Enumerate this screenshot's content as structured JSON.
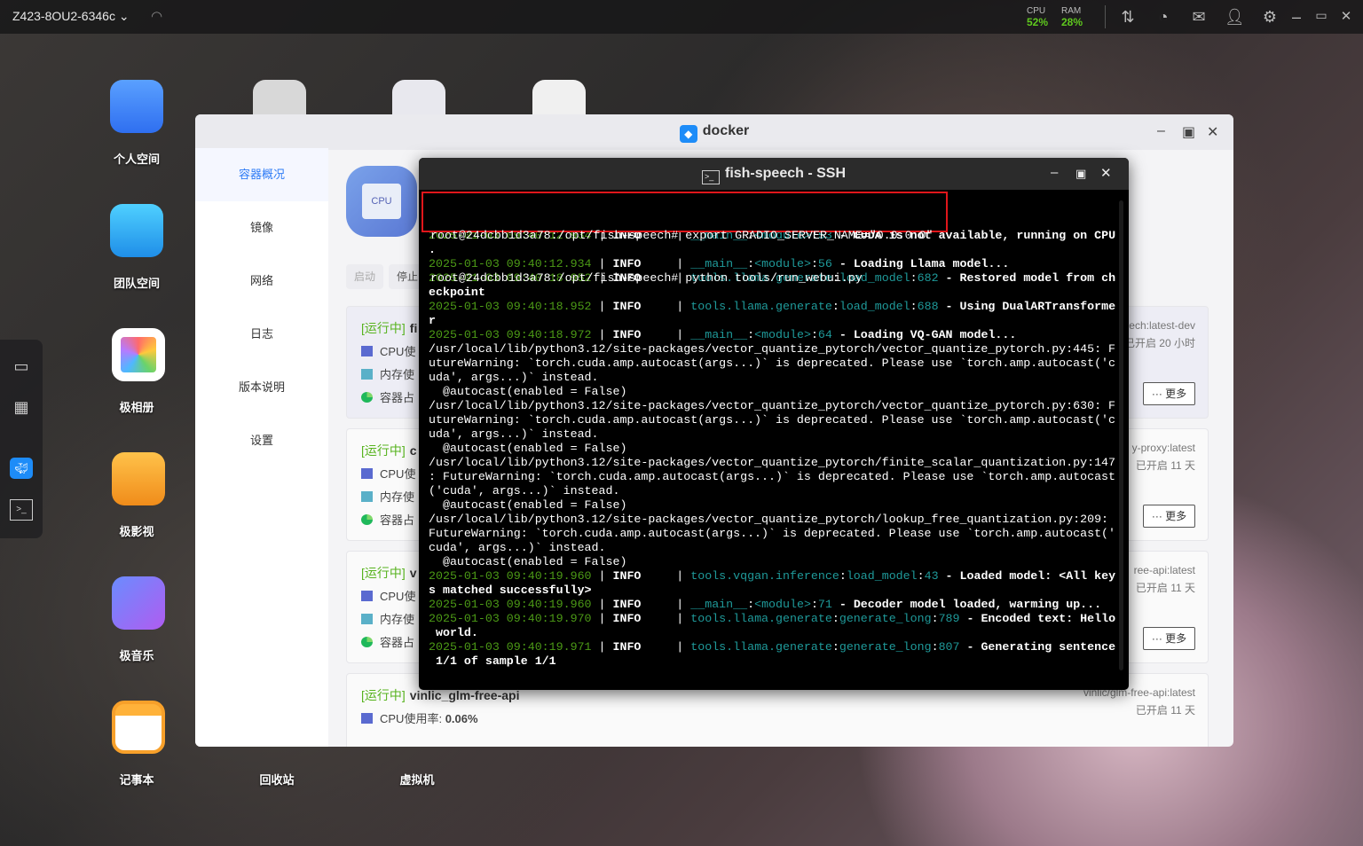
{
  "topbar": {
    "host": "Z423-8OU2-6346c",
    "cpu_label": "CPU",
    "cpu_value": "52%",
    "ram_label": "RAM",
    "ram_value": "28%",
    "accent": "#5fc81e"
  },
  "desktop": {
    "icons": [
      {
        "label": "个人空间",
        "icon": "folder-icon"
      },
      {
        "label": "团队空间",
        "icon": "team-folder-icon"
      },
      {
        "label": "极相册",
        "icon": "photos-icon"
      },
      {
        "label": "极影视",
        "icon": "video-icon"
      },
      {
        "label": "极音乐",
        "icon": "music-icon"
      },
      {
        "label": "记事本",
        "icon": "notepad-icon"
      },
      {
        "label": "回收站",
        "icon": "trash-icon"
      },
      {
        "label": "虚拟机",
        "icon": "vm-icon"
      }
    ]
  },
  "docker": {
    "title": "docker",
    "sidebar": [
      "容器概况",
      "镜像",
      "网络",
      "日志",
      "版本说明",
      "设置"
    ],
    "buttons": {
      "start": "启动",
      "stop": "停止"
    },
    "cards": [
      {
        "status": "[运行中]",
        "name": "fi",
        "rows": [
          "CPU使",
          "内存使",
          "容器占"
        ],
        "image": "ech:latest-dev",
        "uptime": "已开启 20 小时",
        "more": "··· 更多"
      },
      {
        "status": "[运行中]",
        "name": "c",
        "rows": [
          "CPU使",
          "内存使",
          "容器占"
        ],
        "image": "y-proxy:latest",
        "uptime": "已开启 11 天",
        "more": "··· 更多"
      },
      {
        "status": "[运行中]",
        "name": "v",
        "rows": [
          "CPU使",
          "内存使",
          "容器占"
        ],
        "image": "ree-api:latest",
        "uptime": "已开启 11 天",
        "more": "··· 更多"
      },
      {
        "status": "[运行中]",
        "name": "vinlic_glm-free-api",
        "rows": [
          "CPU使用率:"
        ],
        "cpu_value": "0.06%",
        "image": "vinlic/glm-free-api:latest",
        "uptime": "已开启 11 天"
      }
    ]
  },
  "terminal": {
    "title": "fish-speech - SSH",
    "commands": [
      "root@24dcbb1d3a78:/opt/fish-speech# export GRADIO_SERVER_NAME=\"0.0.0.0\"",
      "root@24dcbb1d3a78:/opt/fish-speech# python tools/run_webui.py"
    ],
    "lines": [
      [
        [
          "2025-01-03 09:40:12.934",
          "ts"
        ],
        " | ",
        [
          "INFO",
          "lv"
        ],
        "     | ",
        [
          "__main__",
          "m"
        ],
        ":",
        [
          "<module>",
          "m"
        ],
        ":",
        [
          "53",
          "m"
        ],
        [
          " - CUDA is not available, running on CPU",
          "b"
        ]
      ],
      [
        [
          ".",
          "b"
        ]
      ],
      [
        [
          "2025-01-03 09:40:12.934",
          "ts"
        ],
        " | ",
        [
          "INFO",
          "lv"
        ],
        "     | ",
        [
          "__main__",
          "m"
        ],
        ":",
        [
          "<module>",
          "m"
        ],
        ":",
        [
          "56",
          "m"
        ],
        [
          " - Loading Llama model...",
          "b"
        ]
      ],
      [
        [
          "2025-01-03 09:40:18.952",
          "ts"
        ],
        " | ",
        [
          "INFO",
          "lv"
        ],
        "     | ",
        [
          "tools.llama.generate",
          "m"
        ],
        ":",
        [
          "load_model",
          "m"
        ],
        ":",
        [
          "682",
          "m"
        ],
        [
          " - Restored model from ch",
          "b"
        ]
      ],
      [
        [
          "eckpoint",
          "b"
        ]
      ],
      [
        [
          "2025-01-03 09:40:18.952",
          "ts"
        ],
        " | ",
        [
          "INFO",
          "lv"
        ],
        "     | ",
        [
          "tools.llama.generate",
          "m"
        ],
        ":",
        [
          "load_model",
          "m"
        ],
        ":",
        [
          "688",
          "m"
        ],
        [
          " - Using DualARTransforme",
          "b"
        ]
      ],
      [
        [
          "r",
          "b"
        ]
      ],
      [
        [
          "2025-01-03 09:40:18.972",
          "ts"
        ],
        " | ",
        [
          "INFO",
          "lv"
        ],
        "     | ",
        [
          "__main__",
          "m"
        ],
        ":",
        [
          "<module>",
          "m"
        ],
        ":",
        [
          "64",
          "m"
        ],
        [
          " - Loading VQ-GAN model...",
          "b"
        ]
      ],
      [
        "/usr/local/lib/python3.12/site-packages/vector_quantize_pytorch/vector_quantize_pytorch.py:445: F"
      ],
      [
        "utureWarning: `torch.cuda.amp.autocast(args...)` is deprecated. Please use `torch.amp.autocast('c"
      ],
      [
        "uda', args...)` instead."
      ],
      [
        "  @autocast(enabled = False)"
      ],
      [
        "/usr/local/lib/python3.12/site-packages/vector_quantize_pytorch/vector_quantize_pytorch.py:630: F"
      ],
      [
        "utureWarning: `torch.cuda.amp.autocast(args...)` is deprecated. Please use `torch.amp.autocast('c"
      ],
      [
        "uda', args...)` instead."
      ],
      [
        "  @autocast(enabled = False)"
      ],
      [
        "/usr/local/lib/python3.12/site-packages/vector_quantize_pytorch/finite_scalar_quantization.py:147"
      ],
      [
        ": FutureWarning: `torch.cuda.amp.autocast(args...)` is deprecated. Please use `torch.amp.autocast"
      ],
      [
        "('cuda', args...)` instead."
      ],
      [
        "  @autocast(enabled = False)"
      ],
      [
        "/usr/local/lib/python3.12/site-packages/vector_quantize_pytorch/lookup_free_quantization.py:209:"
      ],
      [
        "FutureWarning: `torch.cuda.amp.autocast(args...)` is deprecated. Please use `torch.amp.autocast('"
      ],
      [
        "cuda', args...)` instead."
      ],
      [
        "  @autocast(enabled = False)"
      ],
      [
        [
          "2025-01-03 09:40:19.960",
          "ts"
        ],
        " | ",
        [
          "INFO",
          "lv"
        ],
        "     | ",
        [
          "tools.vqgan.inference",
          "m"
        ],
        ":",
        [
          "load_model",
          "m"
        ],
        ":",
        [
          "43",
          "m"
        ],
        [
          " - Loaded model: <All key",
          "b"
        ]
      ],
      [
        [
          "s matched successfully>",
          "b"
        ]
      ],
      [
        [
          "2025-01-03 09:40:19.960",
          "ts"
        ],
        " | ",
        [
          "INFO",
          "lv"
        ],
        "     | ",
        [
          "__main__",
          "m"
        ],
        ":",
        [
          "<module>",
          "m"
        ],
        ":",
        [
          "71",
          "m"
        ],
        [
          " - Decoder model loaded, warming up...",
          "b"
        ]
      ],
      [
        [
          "2025-01-03 09:40:19.970",
          "ts"
        ],
        " | ",
        [
          "INFO",
          "lv"
        ],
        "     | ",
        [
          "tools.llama.generate",
          "m"
        ],
        ":",
        [
          "generate_long",
          "m"
        ],
        ":",
        [
          "789",
          "m"
        ],
        [
          " - Encoded text: Hello",
          "b"
        ]
      ],
      [
        [
          " world.",
          "b"
        ]
      ],
      [
        [
          "2025-01-03 09:40:19.971",
          "ts"
        ],
        " | ",
        [
          "INFO",
          "lv"
        ],
        "     | ",
        [
          "tools.llama.generate",
          "m"
        ],
        ":",
        [
          "generate_long",
          "m"
        ],
        ":",
        [
          "807",
          "m"
        ],
        [
          " - Generating sentence",
          "b"
        ]
      ],
      [
        [
          " 1/1 of sample 1/1",
          "b"
        ]
      ]
    ]
  }
}
